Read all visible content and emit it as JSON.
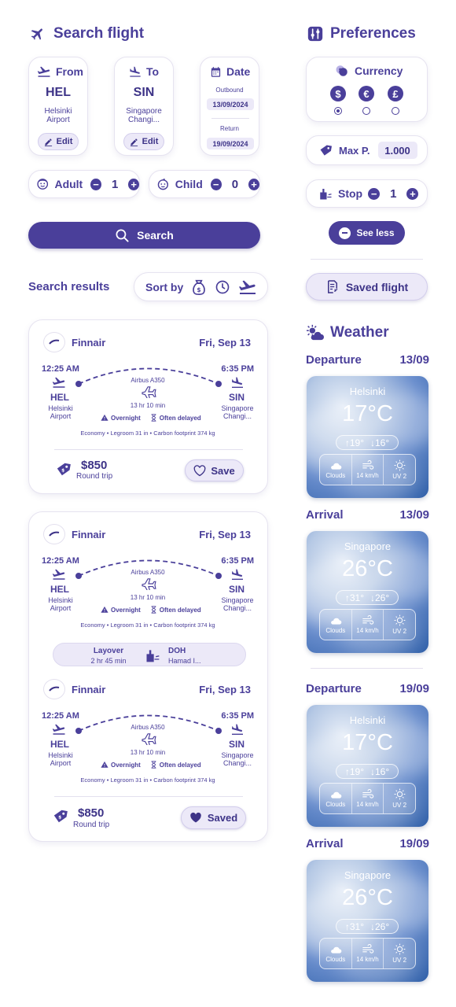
{
  "search": {
    "title": "Search flight",
    "from": {
      "label": "From",
      "code": "HEL",
      "name": "Helsinki Airport",
      "edit": "Edit"
    },
    "to": {
      "label": "To",
      "code": "SIN",
      "name": "Singapore Changi...",
      "edit": "Edit"
    },
    "date": {
      "label": "Date",
      "outbound_label": "Outbound",
      "outbound": "13/09/2024",
      "return_label": "Return",
      "return": "19/09/2024"
    },
    "adult": {
      "label": "Adult",
      "value": "1"
    },
    "child": {
      "label": "Child",
      "value": "0"
    },
    "search_button": "Search"
  },
  "results": {
    "title": "Search results",
    "sort_label": "Sort by",
    "card1": {
      "airline": "Finnair",
      "date": "Fri, Sep 13",
      "dep_time": "12:25 AM",
      "dep_code": "HEL",
      "dep_name": "Helsinki Airport",
      "arr_time": "6:35 PM",
      "arr_code": "SIN",
      "arr_name": "Singapore Changi...",
      "aircraft": "Airbus A350",
      "duration": "13 hr 10 min",
      "tag1": "Overnight",
      "tag2": "Often delayed",
      "details": "Economy • Legroom 31 in • Carbon footprint 374 kg",
      "price": "$850",
      "trip": "Round trip",
      "save": "Save"
    },
    "card2": {
      "seg1": {
        "airline": "Finnair",
        "date": "Fri, Sep 13",
        "dep_time": "12:25 AM",
        "dep_code": "HEL",
        "dep_name": "Helsinki Airport",
        "arr_time": "6:35 PM",
        "arr_code": "SIN",
        "arr_name": "Singapore Changi...",
        "aircraft": "Airbus A350",
        "duration": "13 hr 10 min",
        "tag1": "Overnight",
        "tag2": "Often delayed",
        "details": "Economy • Legroom 31 in • Carbon footprint 374 kg"
      },
      "layover": {
        "label": "Layover",
        "duration": "2 hr 45 min",
        "code": "DOH",
        "name": "Hamad I..."
      },
      "seg2": {
        "airline": "Finnair",
        "date": "Fri, Sep 13",
        "dep_time": "12:25 AM",
        "dep_code": "HEL",
        "dep_name": "Helsinki Airport",
        "arr_time": "6:35 PM",
        "arr_code": "SIN",
        "arr_name": "Singapore Changi...",
        "aircraft": "Airbus A350",
        "duration": "13 hr 10 min",
        "tag1": "Overnight",
        "tag2": "Often delayed",
        "details": "Economy • Legroom 31 in • Carbon footprint 374 kg"
      },
      "price": "$850",
      "trip": "Round trip",
      "saved": "Saved"
    }
  },
  "preferences": {
    "title": "Preferences",
    "currency_label": "Currency",
    "currencies": [
      "$",
      "€",
      "£"
    ],
    "selected_currency": "$",
    "maxp_label": "Max P.",
    "maxp_value": "1.000",
    "stop_label": "Stop",
    "stop_value": "1",
    "see_less": "See less",
    "saved_flight": "Saved flight"
  },
  "weather": {
    "title": "Weather",
    "blocks": [
      {
        "label": "Departure",
        "date": "13/09",
        "city": "Helsinki",
        "temp": "17°C",
        "high": "↑19°",
        "low": "↓16°",
        "clouds": "Clouds",
        "wind": "14 km/h",
        "uv": "UV 2"
      },
      {
        "label": "Arrival",
        "date": "13/09",
        "city": "Singapore",
        "temp": "26°C",
        "high": "↑31°",
        "low": "↓26°",
        "clouds": "Clouds",
        "wind": "14 km/h",
        "uv": "UV 2"
      },
      {
        "label": "Departure",
        "date": "19/09",
        "city": "Helsinki",
        "temp": "17°C",
        "high": "↑19°",
        "low": "↓16°",
        "clouds": "Clouds",
        "wind": "14 km/h",
        "uv": "UV 2"
      },
      {
        "label": "Arrival",
        "date": "19/09",
        "city": "Singapore",
        "temp": "26°C",
        "high": "↑31°",
        "low": "↓26°",
        "clouds": "Clouds",
        "wind": "14 km/h",
        "uv": "UV 2"
      }
    ]
  },
  "colors": {
    "accent": "#4a3f9a",
    "accent_light": "#ece9f8",
    "background": "#ffffff"
  }
}
